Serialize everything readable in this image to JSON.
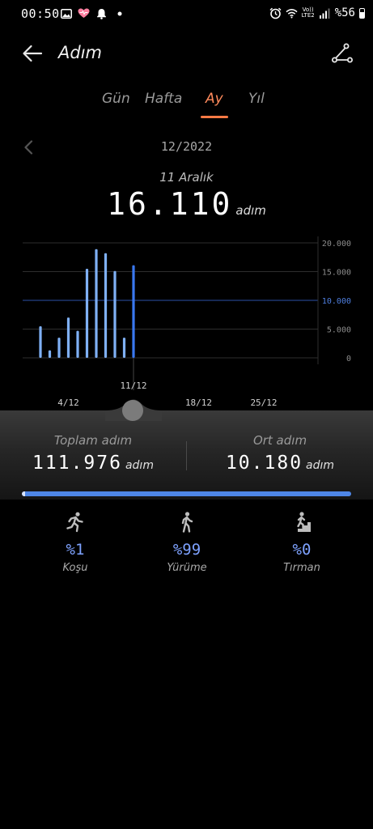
{
  "status_bar": {
    "time": "00:50",
    "battery": "%56",
    "volte": "Vo))",
    "network": "LTE2"
  },
  "header": {
    "title": "Adım"
  },
  "tabs": [
    {
      "label": "Gün",
      "active": false
    },
    {
      "label": "Hafta",
      "active": false
    },
    {
      "label": "Ay",
      "active": true
    },
    {
      "label": "Yıl",
      "active": false
    }
  ],
  "period": {
    "label": "12/2022"
  },
  "selected": {
    "day_label": "11 Aralık",
    "value": "16.110",
    "unit": "adım"
  },
  "chart_data": {
    "type": "bar",
    "y_tick_labels": [
      "20.000",
      "15.000",
      "10.000",
      "5.000",
      "0"
    ],
    "y_ticks": [
      20000,
      15000,
      10000,
      5000,
      0
    ],
    "goal_label": "10.000",
    "goal": 10000,
    "ylim": [
      0,
      20000
    ],
    "x": [
      1,
      2,
      3,
      4,
      5,
      6,
      7,
      8,
      9,
      10,
      11
    ],
    "values": [
      5500,
      1300,
      3500,
      7000,
      4700,
      15500,
      18900,
      18200,
      15100,
      3500,
      16110
    ],
    "selected_index": 10,
    "x_tick_labels": [
      "4/12",
      "11/12",
      "18/12",
      "25/12"
    ],
    "x_ticks": [
      4,
      11,
      18,
      25
    ],
    "days_in_month": 31,
    "bar_color": "#7fb0f5",
    "selected_color": "#3a78f0",
    "goal_color": "#2b4fa8"
  },
  "stats": {
    "total_label": "Toplam adım",
    "total_value": "111.976",
    "total_unit": "adım",
    "avg_label": "Ort adım",
    "avg_value": "10.180",
    "avg_unit": "adım"
  },
  "activity_share": {
    "run_fraction": 0.01,
    "walk_fraction": 0.99
  },
  "activities": [
    {
      "icon": "running-icon",
      "pct": "%1",
      "label": "Koşu"
    },
    {
      "icon": "walking-icon",
      "pct": "%99",
      "label": "Yürüme"
    },
    {
      "icon": "climbing-icon",
      "pct": "%0",
      "label": "Tırman"
    }
  ]
}
